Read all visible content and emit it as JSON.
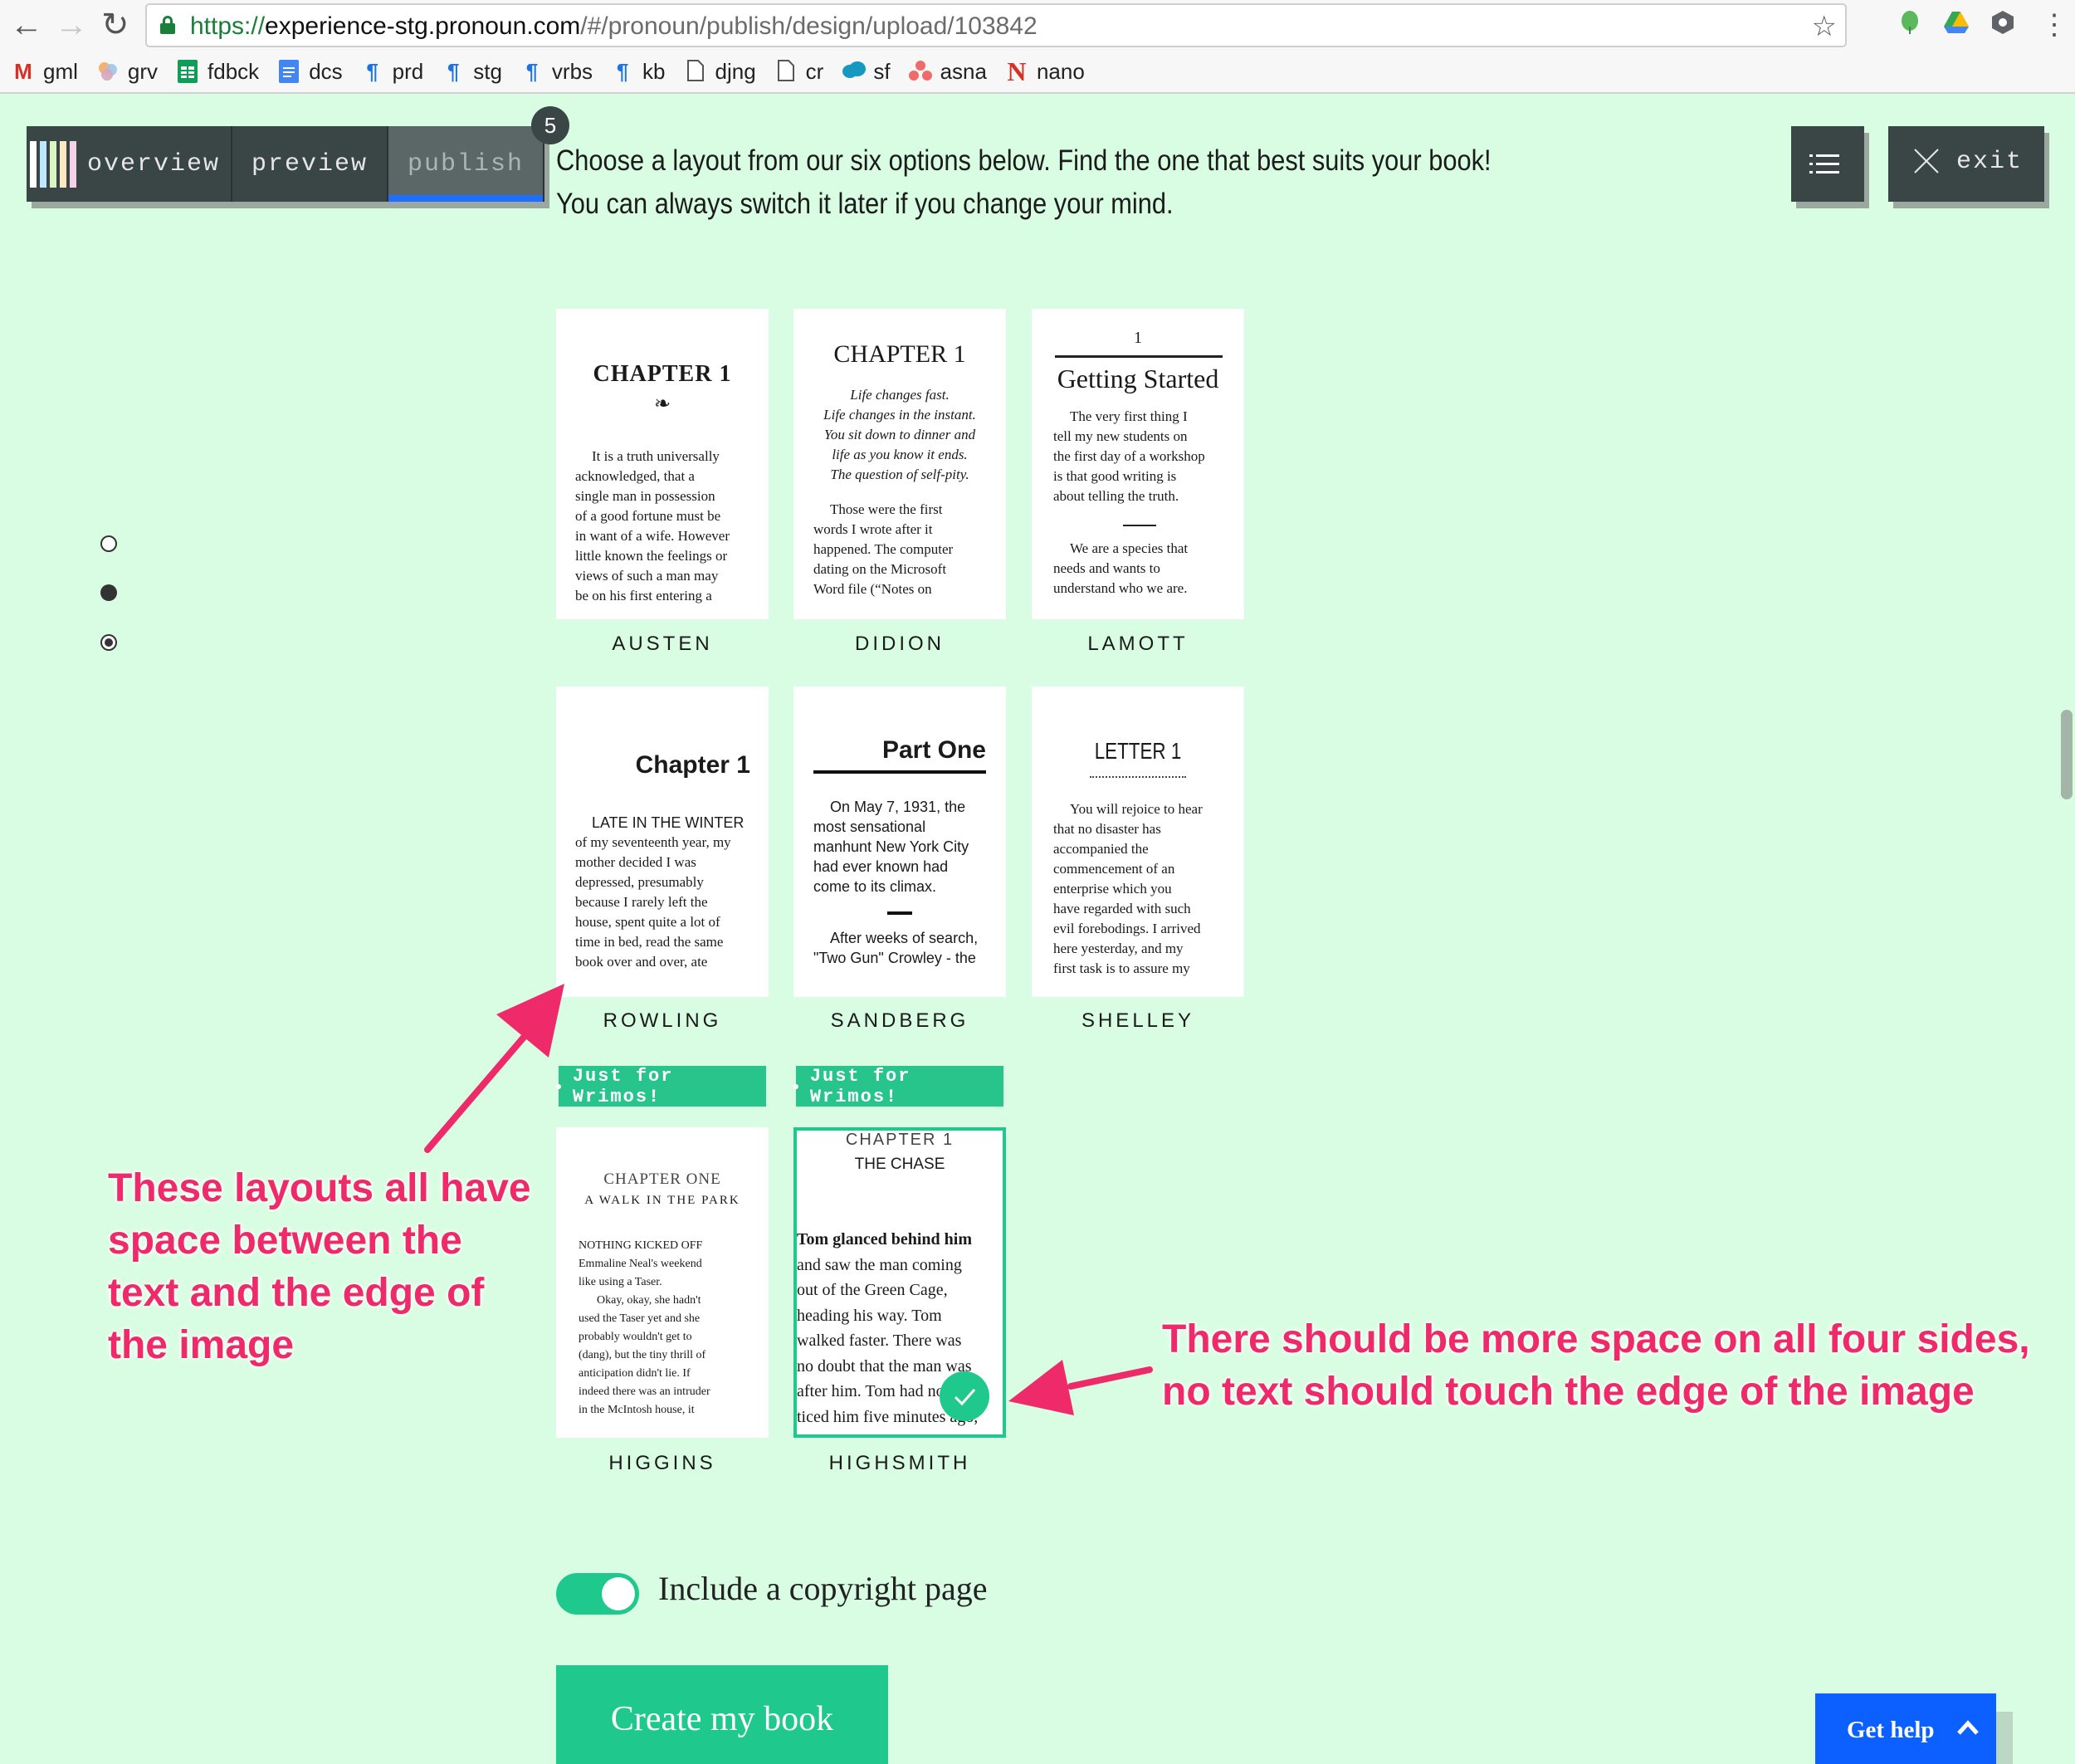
{
  "browser": {
    "url_protocol": "https://",
    "url_host": "experience-stg.pronoun.com",
    "url_path": "/#/pronoun/publish/design/upload/103842",
    "bookmarks": [
      {
        "icon": "gmail-icon",
        "label": "gml"
      },
      {
        "icon": "pinwheel-icon",
        "label": "grv"
      },
      {
        "icon": "sheets-icon",
        "label": "fdbck"
      },
      {
        "icon": "docs-icon",
        "label": "dcs"
      },
      {
        "icon": "pilcrow-icon",
        "label": "prd"
      },
      {
        "icon": "pilcrow-icon",
        "label": "stg"
      },
      {
        "icon": "pilcrow-icon",
        "label": "vrbs"
      },
      {
        "icon": "pilcrow-icon",
        "label": "kb"
      },
      {
        "icon": "page-icon",
        "label": "djng"
      },
      {
        "icon": "page-icon",
        "label": "cr"
      },
      {
        "icon": "cloud-icon",
        "label": "sf"
      },
      {
        "icon": "asana-icon",
        "label": "asna"
      },
      {
        "icon": "n-logo-icon",
        "label": "nano"
      }
    ]
  },
  "nav": {
    "tabs": [
      "overview",
      "preview",
      "publish"
    ],
    "active_tab": "publish",
    "badge": "5",
    "exit_label": "exit",
    "logo_colors": [
      "#ffffff",
      "#bfe7ff",
      "#d9f5c4",
      "#ffe7c2",
      "#f6d1ea"
    ]
  },
  "intro": {
    "line1": "Choose a layout from our six options below. Find the one that best suits your book!",
    "line2": "You can always switch it later if you change your mind."
  },
  "layouts": {
    "austen": {
      "name": "AUSTEN",
      "heading": "CHAPTER 1",
      "ornament": "❧",
      "body": [
        "It is a truth universally",
        "acknowledged, that a",
        "single man in possession",
        "of a good fortune must be",
        "in want of a wife. However",
        "little known the feelings or",
        "views of such a man may",
        "be on his first entering a"
      ]
    },
    "didion": {
      "name": "DIDION",
      "heading": "CHAPTER 1",
      "epigraph": [
        "Life changes fast.",
        "Life changes in the instant.",
        "You sit down to dinner and",
        "life as you know it ends.",
        "The question of self-pity."
      ],
      "body": [
        "Those were the first",
        "words I wrote after it",
        "happened. The computer",
        "dating on the Microsoft",
        "Word file (“Notes on"
      ]
    },
    "lamott": {
      "name": "LAMOTT",
      "number": "1",
      "heading": "Getting Started",
      "body": [
        "The very first thing I",
        "tell my new students on",
        "the first day of a workshop",
        "is that good writing is",
        "about telling the truth."
      ],
      "body2": [
        "We are a species that",
        "needs and wants to",
        "understand who we are."
      ]
    },
    "rowling": {
      "name": "ROWLING",
      "heading": "Chapter 1",
      "lead": "LATE IN THE WINTER",
      "body": [
        "of my seventeenth year, my",
        "mother decided I was",
        "depressed, presumably",
        "because I rarely left the",
        "house, spent quite a lot of",
        "time in bed, read the same",
        "book over and over, ate"
      ]
    },
    "sandberg": {
      "name": "SANDBERG",
      "heading": "Part One",
      "body": [
        "On May 7, 1931, the",
        "most sensational",
        "manhunt New York City",
        "had ever known had",
        "come to its climax."
      ],
      "body2": [
        "After weeks of search,",
        "\"Two Gun\" Crowley - the"
      ]
    },
    "shelley": {
      "name": "SHELLEY",
      "heading": "LETTER 1",
      "body": [
        "You will rejoice to hear",
        "that no disaster has",
        "accompanied the",
        "commencement of an",
        "enterprise which you",
        "have regarded with such",
        "evil forebodings. I arrived",
        "here yesterday, and my",
        "first task is to assure my"
      ]
    },
    "higgins": {
      "name": "HIGGINS",
      "badge": "Just for Wrimos!",
      "heading": "CHAPTER ONE",
      "subheading": "A WALK IN THE PARK",
      "body": [
        "NOTHING KICKED OFF",
        "Emmaline Neal's weekend",
        "like using a Taser.",
        "Okay, okay, she hadn't",
        "used the Taser yet and she",
        "probably wouldn't get to",
        "(dang), but the tiny thrill of",
        "anticipation didn't lie. If",
        "indeed there was an intruder",
        "in the McIntosh house, it"
      ]
    },
    "highsmith": {
      "name": "HIGHSMITH",
      "badge": "Just for Wrimos!",
      "heading": "CHAPTER 1",
      "subheading": "THE CHASE",
      "lead": "Tom glanced behind him",
      "body": [
        "and saw the man coming",
        "out of the Green Cage,",
        "heading his way. Tom",
        "walked faster. There was",
        "no doubt that the man was",
        "after him. Tom had no-",
        "ticed him five minutes ago,"
      ],
      "selected": true
    }
  },
  "annotations": {
    "left": [
      "These layouts all have",
      "space between the",
      "text and the edge of",
      "the image"
    ],
    "right": [
      "There should be more space on all four sides,",
      "no text should touch the edge of the image"
    ]
  },
  "copyright_toggle": {
    "label": "Include a copyright page",
    "on": true
  },
  "create_button": "Create my book",
  "help_button": "Get help",
  "colors": {
    "accent_green": "#1fc98e",
    "annotation_pink": "#ee2a6a",
    "nav_dark": "#3a4646",
    "help_blue": "#0b60ff"
  }
}
